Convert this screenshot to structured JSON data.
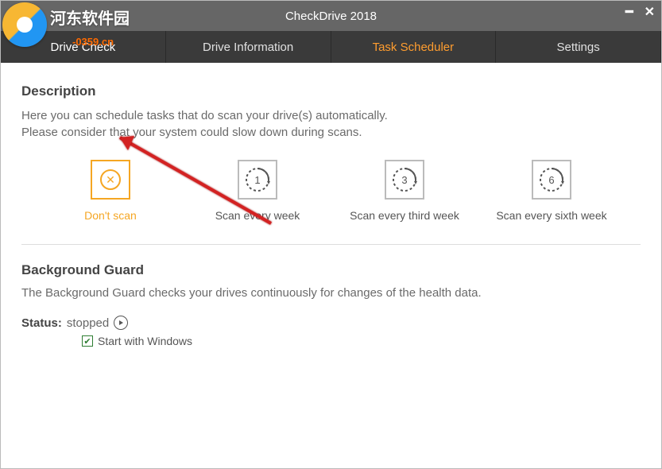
{
  "window": {
    "title": "CheckDrive 2018"
  },
  "branding": {
    "name": "河东软件园",
    "url": "-0359.cn"
  },
  "tabs": [
    {
      "label": "Drive Check",
      "active": false
    },
    {
      "label": "Drive Information",
      "active": false
    },
    {
      "label": "Task Scheduler",
      "active": true
    },
    {
      "label": "Settings",
      "active": false
    }
  ],
  "description": {
    "title": "Description",
    "line1": "Here you can schedule tasks that do scan your drive(s) automatically.",
    "line2": "Please consider that your system could slow down during scans."
  },
  "scanOptions": [
    {
      "label": "Don't scan",
      "selected": true,
      "icon": "x-circle"
    },
    {
      "label": "Scan every week",
      "selected": false,
      "number": "1"
    },
    {
      "label": "Scan every third week",
      "selected": false,
      "number": "3"
    },
    {
      "label": "Scan every sixth week",
      "selected": false,
      "number": "6"
    }
  ],
  "backgroundGuard": {
    "title": "Background Guard",
    "desc": "The Background Guard checks your drives continuously for changes of the health data.",
    "statusLabel": "Status:",
    "statusValue": "stopped",
    "startWithWindows": {
      "label": "Start with Windows",
      "checked": true
    }
  }
}
